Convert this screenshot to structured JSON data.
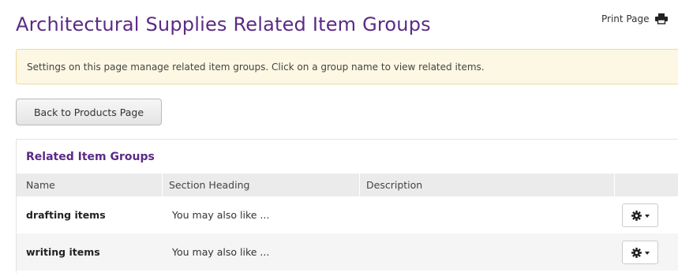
{
  "page": {
    "title": "Architectural Supplies Related Item Groups",
    "print_label": "Print Page",
    "alert_text": "Settings on this page manage related item groups. Click on a group name to view related items.",
    "back_button_label": "Back to Products Page"
  },
  "panel": {
    "heading": "Related Item Groups",
    "columns": [
      "Name",
      "Section Heading",
      "Description"
    ],
    "rows": [
      {
        "name": "drafting items",
        "section_heading": "You may also like ...",
        "description": "",
        "actions_icon": "gear-icon"
      },
      {
        "name": "writing items",
        "section_heading": "You may also like ...",
        "description": "",
        "actions_icon": "gear-icon"
      }
    ]
  },
  "colors": {
    "title_purple": "#5b2a86",
    "alert_bg": "#fcf8e3",
    "alert_border": "#f3d79a",
    "header_bg": "#ebebeb",
    "alt_row_bg": "#f5f5f5"
  }
}
